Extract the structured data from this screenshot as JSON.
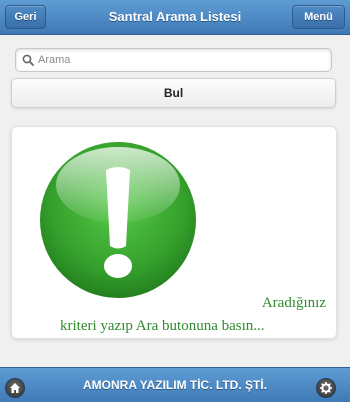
{
  "header": {
    "back_label": "Geri",
    "title": "Santral Arama Listesi",
    "menu_label": "Menü"
  },
  "search": {
    "placeholder": "Arama",
    "value": "",
    "icon": "search-icon"
  },
  "search_button_label": "Bul",
  "message": {
    "icon": "exclamation-icon",
    "line1": "Aradığınız",
    "line2": "kriteri yazıp Ara butonuna basın..."
  },
  "footer": {
    "title": "AMONRA YAZILIM TİC. LTD. ŞTİ.",
    "left_icon": "home-icon",
    "right_icon": "gear-icon"
  },
  "colors": {
    "bar_blue": "#4a86c5",
    "message_green": "#2e8b2e",
    "icon_green": "#3aa52f"
  }
}
